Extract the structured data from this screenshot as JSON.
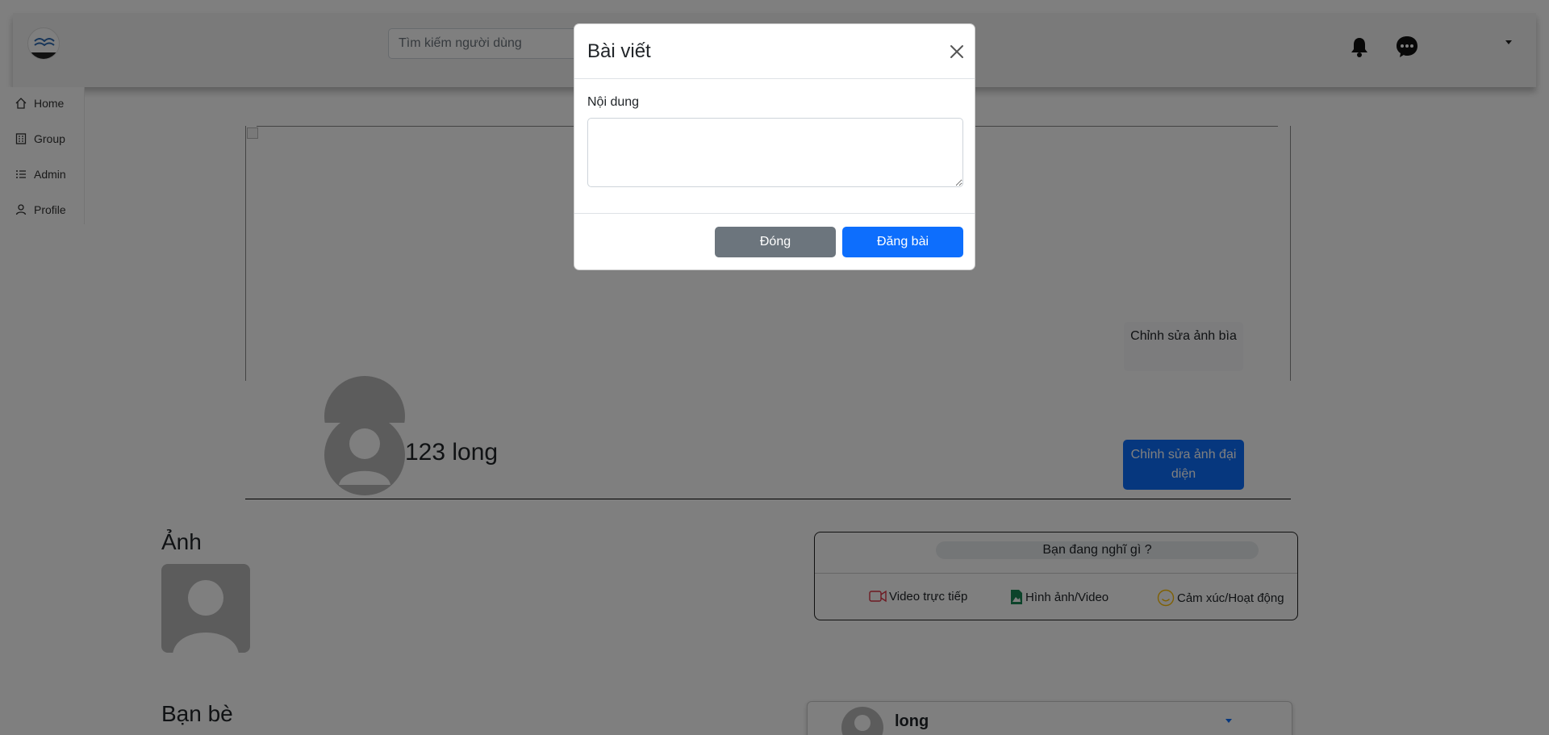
{
  "header": {
    "search_placeholder": "Tìm kiếm người dùng"
  },
  "sidebar": {
    "items": [
      {
        "label": "Home",
        "icon": "home-icon"
      },
      {
        "label": "Group",
        "icon": "building-icon"
      },
      {
        "label": "Admin",
        "icon": "list-icon"
      },
      {
        "label": "Profile",
        "icon": "person-icon"
      }
    ]
  },
  "profile": {
    "edit_cover_label": "Chỉnh sửa ảnh bìa",
    "name": "123 long",
    "edit_avatar_label": "Chỉnh sửa ảnh đại diện"
  },
  "photos": {
    "title": "Ảnh"
  },
  "friends": {
    "title": "Bạn bè"
  },
  "composer": {
    "prompt": "Bạn đang nghĩ gì ?",
    "actions": [
      {
        "label": "Video trực tiếp",
        "icon": "video-icon",
        "color": "#dc3545"
      },
      {
        "label": "Hình ảnh/Video",
        "icon": "image-file-icon",
        "color": "#198754"
      },
      {
        "label": "Cảm xúc/Hoạt động",
        "icon": "smile-icon",
        "color": "#ffc107"
      }
    ]
  },
  "feed": {
    "author": "long"
  },
  "modal": {
    "title": "Bài viết",
    "content_label": "Nội dung",
    "content_value": "",
    "close_label": "Đóng",
    "submit_label": "Đăng bài"
  },
  "colors": {
    "primary": "#0d6efd",
    "secondary": "#6c757d",
    "backdrop": "rgba(0,0,0,0.5)"
  }
}
